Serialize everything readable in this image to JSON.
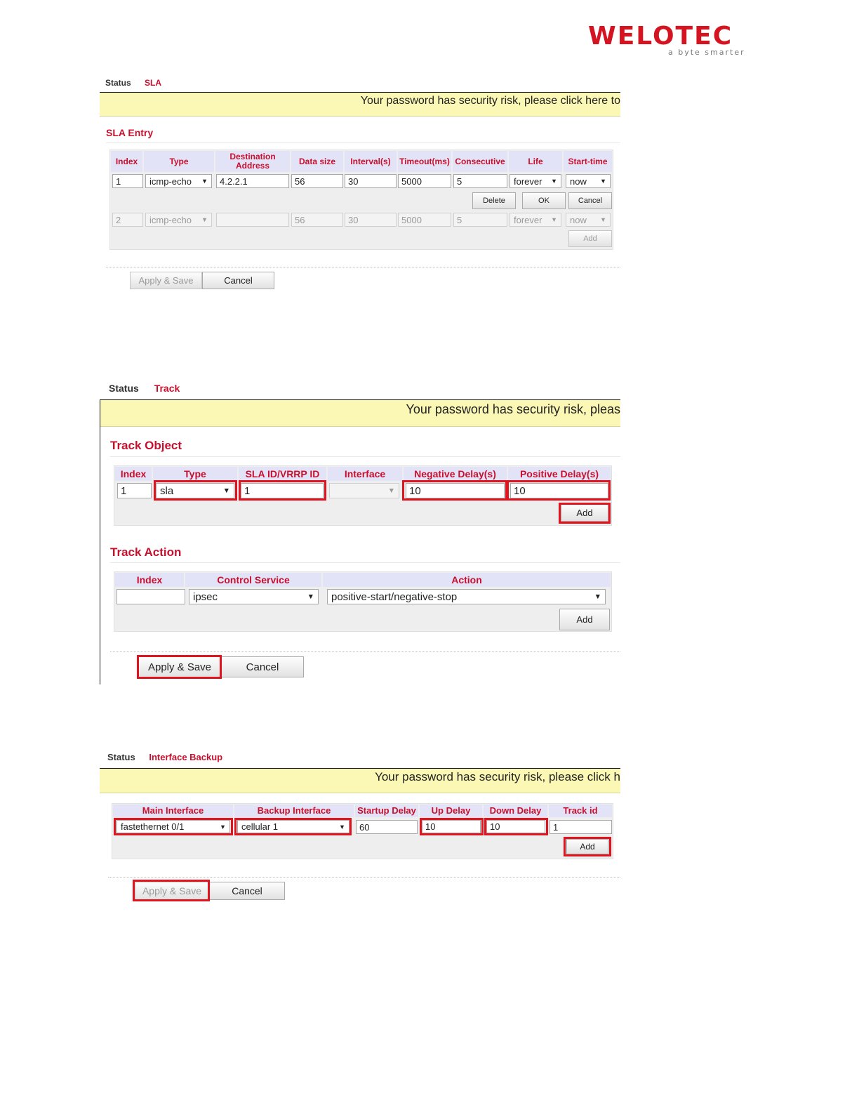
{
  "logo": {
    "wordmark": "welotec",
    "tagline": "a byte smarter"
  },
  "sla": {
    "breadcrumb": {
      "status": "Status",
      "page": "SLA"
    },
    "banner": "Your password has security risk, please click here to",
    "section_title": "SLA Entry",
    "headers": [
      "Index",
      "Type",
      "Destination Address",
      "Data size",
      "Interval(s)",
      "Timeout(ms)",
      "Consecutive",
      "Life",
      "Start-time"
    ],
    "edit_row": {
      "index": "1",
      "type": "icmp-echo",
      "destination": "4.2.2.1",
      "data_size": "56",
      "interval": "30",
      "timeout": "5000",
      "consecutive": "5",
      "life": "forever",
      "start_time": "now"
    },
    "row_buttons": {
      "delete": "Delete",
      "ok": "OK",
      "cancel": "Cancel"
    },
    "new_row": {
      "index": "2",
      "type": "icmp-echo",
      "destination": "",
      "data_size": "56",
      "interval": "30",
      "timeout": "5000",
      "consecutive": "5",
      "life": "forever",
      "start_time": "now"
    },
    "add_button": "Add",
    "apply_save": "Apply & Save",
    "cancel": "Cancel"
  },
  "track": {
    "breadcrumb": {
      "status": "Status",
      "page": "Track"
    },
    "banner": "Your password has security risk, pleas",
    "object_title": "Track Object",
    "object_headers": [
      "Index",
      "Type",
      "SLA ID/VRRP ID",
      "Interface",
      "Negative Delay(s)",
      "Positive Delay(s)"
    ],
    "object_row": {
      "index": "1",
      "type": "sla",
      "sla_id": "1",
      "interface": "",
      "negative_delay": "10",
      "positive_delay": "10"
    },
    "object_add": "Add",
    "action_title": "Track Action",
    "action_headers": [
      "Index",
      "Control Service",
      "Action"
    ],
    "action_row": {
      "index": "",
      "control_service": "ipsec",
      "action": "positive-start/negative-stop"
    },
    "action_add": "Add",
    "apply_save": "Apply & Save",
    "cancel": "Cancel"
  },
  "backup": {
    "breadcrumb": {
      "status": "Status",
      "page": "Interface Backup"
    },
    "banner": "Your password has security risk, please click h",
    "headers": [
      "Main Interface",
      "Backup Interface",
      "Startup Delay",
      "Up Delay",
      "Down Delay",
      "Track id"
    ],
    "row": {
      "main": "fastethernet 0/1",
      "backup": "cellular 1",
      "startup_delay": "60",
      "up_delay": "10",
      "down_delay": "10",
      "track_id": "1"
    },
    "add_button": "Add",
    "apply_save": "Apply & Save",
    "cancel": "Cancel"
  },
  "colors": {
    "accent": "#c8102e",
    "highlight": "#e0141f",
    "banner": "#fbf7b5",
    "header_bg": "#e3e3f7"
  }
}
